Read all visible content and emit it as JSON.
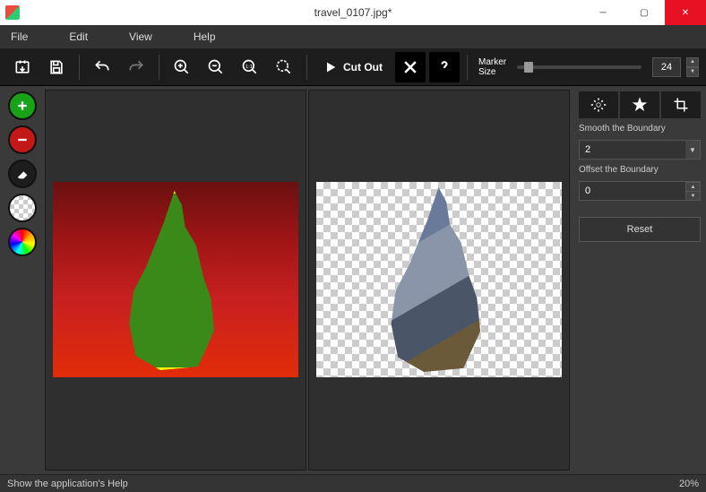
{
  "title": "travel_0107.jpg*",
  "menu": {
    "file": "File",
    "edit": "Edit",
    "view": "View",
    "help": "Help"
  },
  "toolbar": {
    "cutout_label": "Cut Out",
    "marker_label_line1": "Marker",
    "marker_label_line2": "Size",
    "marker_value": "24"
  },
  "right": {
    "smooth_label": "Smooth the Boundary",
    "smooth_value": "2",
    "offset_label": "Offset the Boundary",
    "offset_value": "0",
    "reset_label": "Reset"
  },
  "status": {
    "help_text": "Show the application's Help",
    "zoom": "20%"
  }
}
